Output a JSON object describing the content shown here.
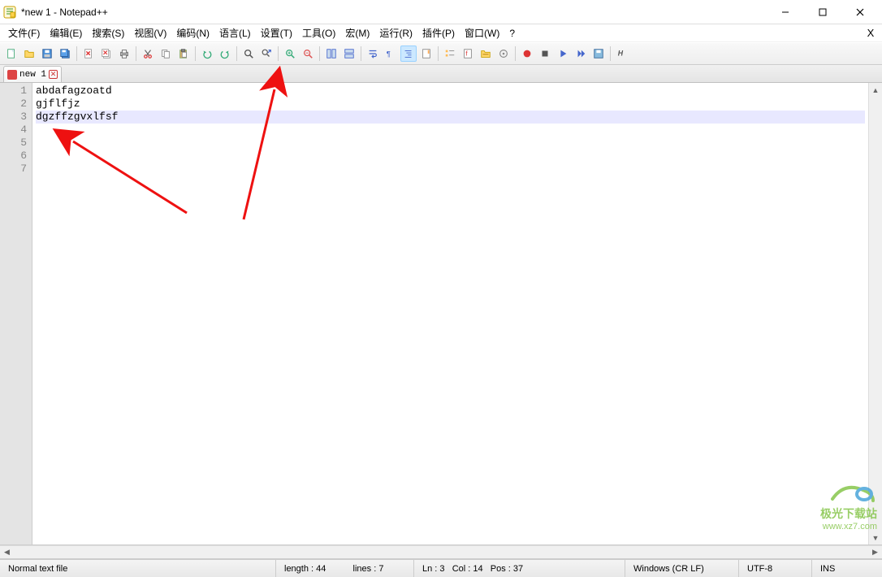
{
  "window": {
    "title": "*new 1 - Notepad++"
  },
  "menus": [
    "文件(F)",
    "编辑(E)",
    "搜索(S)",
    "视图(V)",
    "编码(N)",
    "语言(L)",
    "设置(T)",
    "工具(O)",
    "宏(M)",
    "运行(R)",
    "插件(P)",
    "窗口(W)",
    "?"
  ],
  "tabs": [
    {
      "label": "new 1"
    }
  ],
  "editor": {
    "lines": [
      "abdafagzoatd",
      "gjflfjz",
      "dgzffzgvxlfsf",
      "",
      "",
      "",
      ""
    ],
    "current_line_index": 2
  },
  "gutter": {
    "numbers": [
      "1",
      "2",
      "3",
      "4",
      "5",
      "6",
      "7"
    ]
  },
  "statusbar": {
    "doc_type": "Normal text file",
    "length": "length : 44",
    "lines": "lines : 7",
    "ln": "Ln : 3",
    "col": "Col : 14",
    "pos": "Pos : 37",
    "eol": "Windows (CR LF)",
    "encoding": "UTF-8",
    "mode": "INS"
  },
  "watermark": {
    "name": "极光下载站",
    "url": "www.xz7.com"
  }
}
